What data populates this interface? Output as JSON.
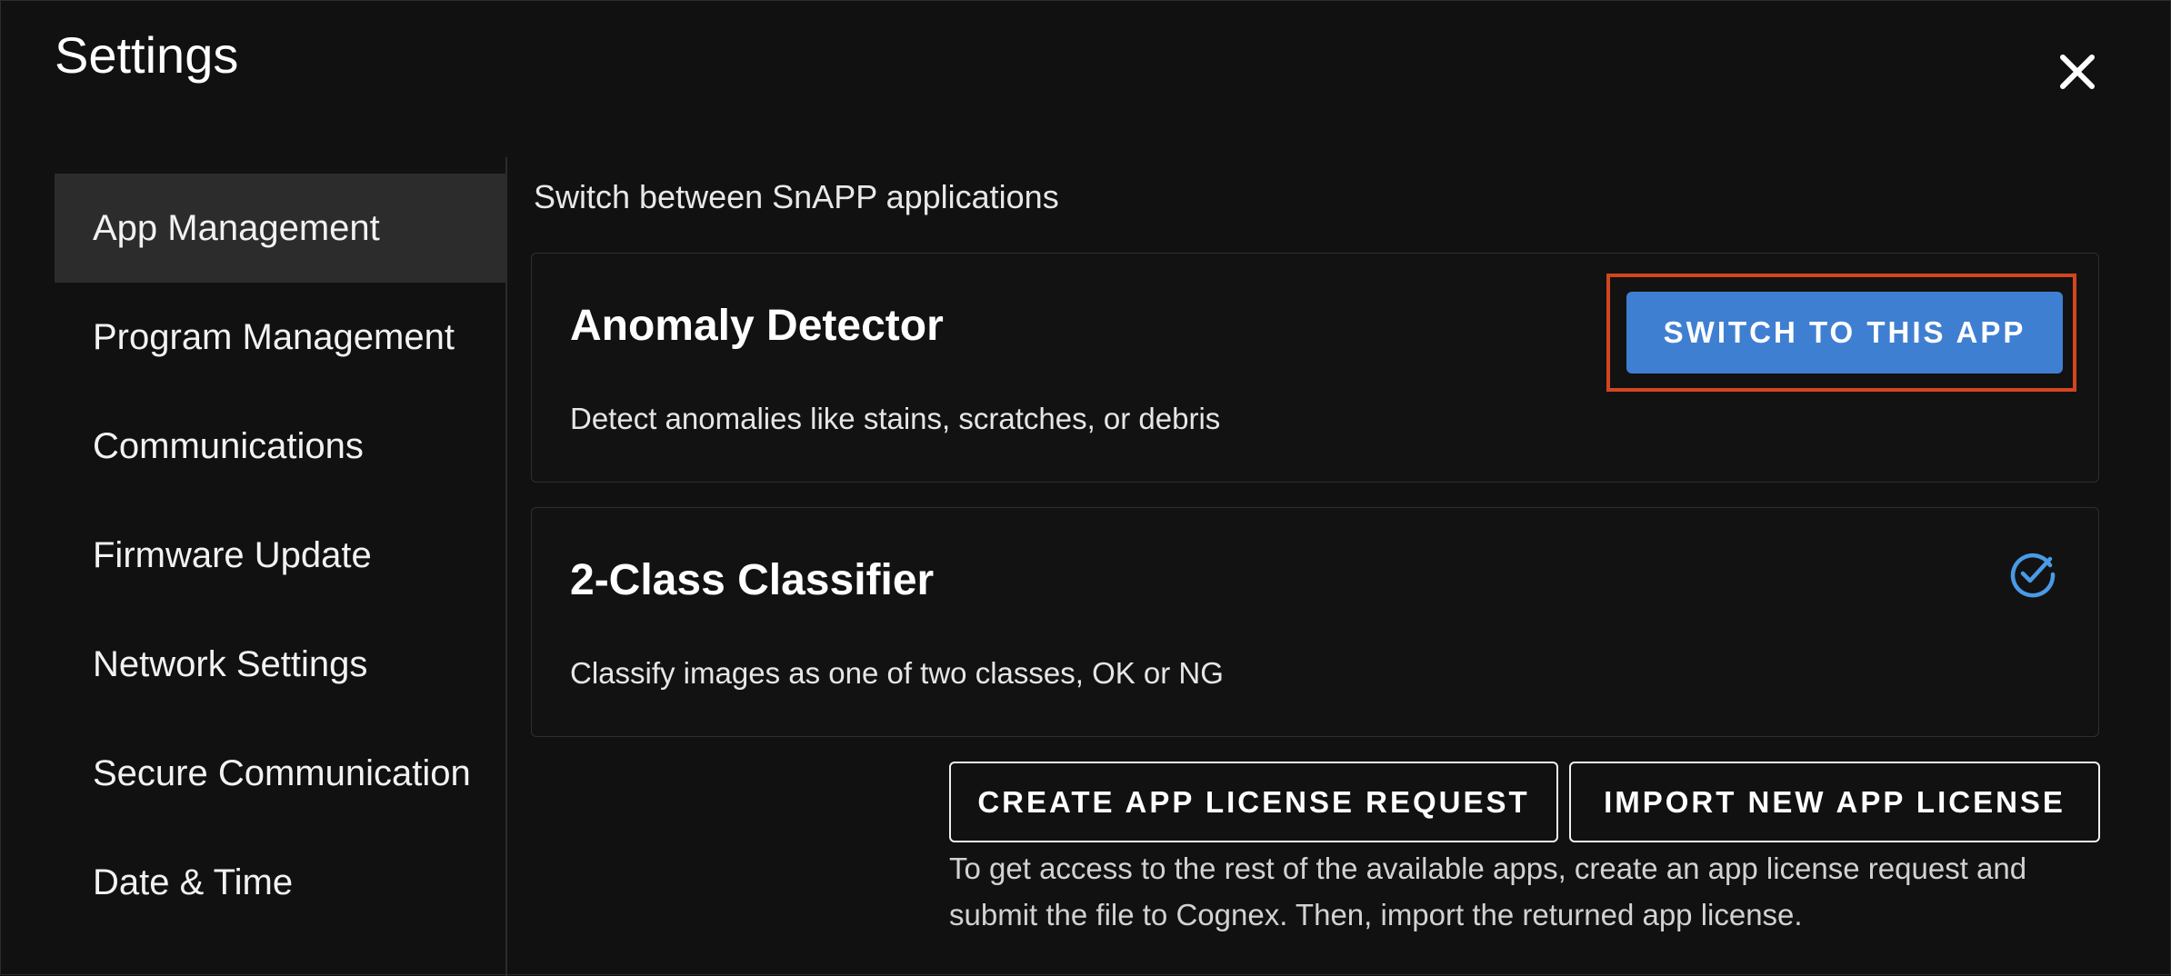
{
  "dialog": {
    "title": "Settings",
    "close_icon": "close-icon"
  },
  "sidebar": {
    "items": [
      {
        "label": "App Management",
        "active": true
      },
      {
        "label": "Program Management",
        "active": false
      },
      {
        "label": "Communications",
        "active": false
      },
      {
        "label": "Firmware Update",
        "active": false
      },
      {
        "label": "Network Settings",
        "active": false
      },
      {
        "label": "Secure Communication",
        "active": false
      },
      {
        "label": "Date & Time",
        "active": false
      }
    ]
  },
  "main": {
    "heading": "Switch between SnAPP applications",
    "apps": [
      {
        "name": "Anomaly Detector",
        "description": "Detect anomalies like stains, scratches, or debris",
        "action_label": "SWITCH TO THIS APP",
        "current": false
      },
      {
        "name": "2-Class Classifier",
        "description": "Classify images as one of two classes, OK or NG",
        "current": true,
        "status_icon": "check-circle-icon"
      }
    ],
    "create_license_label": "CREATE APP LICENSE REQUEST",
    "import_license_label": "IMPORT NEW APP LICENSE",
    "help_text": "To get access to the rest of the available apps, create an app license request and submit the file to Cognex. Then, import the returned app license."
  },
  "colors": {
    "background": "#111111",
    "accent": "#3f7fd1",
    "highlight": "#d2461f",
    "check": "#4a9ae6",
    "active_item": "#2c2c2c"
  }
}
